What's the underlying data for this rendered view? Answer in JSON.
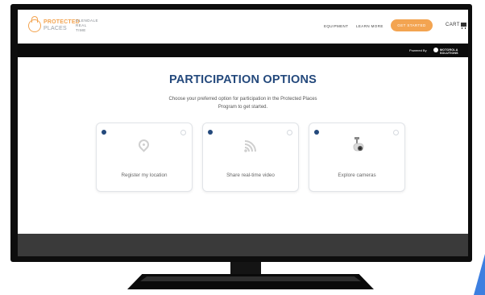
{
  "brand": {
    "line1": "PROTECTED",
    "line2": "PLACES",
    "city_line1": "GLENDALE",
    "city_line2": "REAL",
    "city_line3": "TIME"
  },
  "nav": {
    "equipment": "EQUIPMENT",
    "learn_more": "LEARN MORE",
    "get_started": "GET STARTED",
    "cart": "CART"
  },
  "powered": {
    "label": "Powered By",
    "vendor": "MOTOROLA SOLUTIONS"
  },
  "hero": {
    "title": "PARTICIPATION OPTIONS",
    "subtitle_line1": "Choose your preferred option for participation in the Protected Places",
    "subtitle_line2": "Program to get started."
  },
  "options": [
    {
      "label": "Register my location",
      "icon": "location-pin-icon"
    },
    {
      "label": "Share real-time video",
      "icon": "video-stream-icon"
    },
    {
      "label": "Explore cameras",
      "icon": "security-camera-icon"
    }
  ],
  "colors": {
    "accent": "#f3a451",
    "title": "#24497c",
    "dark_band": "#0b0b0b",
    "footer": "#3a3a3a"
  }
}
